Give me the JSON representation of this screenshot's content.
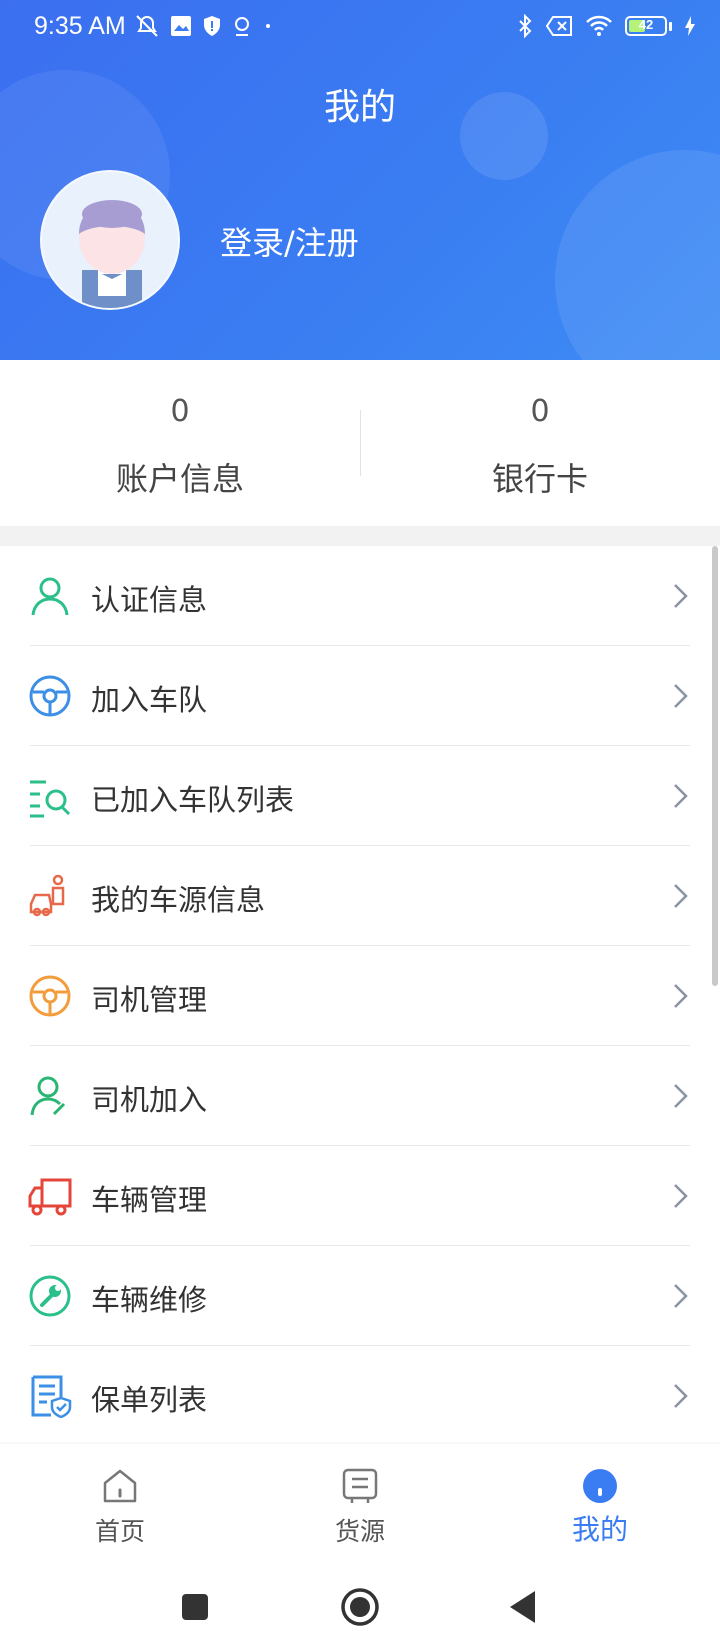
{
  "status_bar": {
    "time": "9:35 AM",
    "battery": "42"
  },
  "header": {
    "title": "我的",
    "login_label": "登录/注册"
  },
  "stats": [
    {
      "value": "0",
      "label": "账户信息"
    },
    {
      "value": "0",
      "label": "银行卡"
    }
  ],
  "menu": {
    "items": [
      {
        "label": "认证信息",
        "icon": "user-certify-icon",
        "color": "#2bc08a"
      },
      {
        "label": "加入车队",
        "icon": "steering-wheel-icon",
        "color": "#3b8fe6"
      },
      {
        "label": "已加入车队列表",
        "icon": "list-search-icon",
        "color": "#2bc08a"
      },
      {
        "label": "我的车源信息",
        "icon": "driver-car-icon",
        "color": "#e8684a"
      },
      {
        "label": "司机管理",
        "icon": "steering-wheel-icon",
        "color": "#f39c3c"
      },
      {
        "label": "司机加入",
        "icon": "user-add-icon",
        "color": "#2bb573"
      },
      {
        "label": "车辆管理",
        "icon": "truck-icon",
        "color": "#e5463a"
      },
      {
        "label": "车辆维修",
        "icon": "wrench-icon",
        "color": "#2bc08a"
      },
      {
        "label": "保单列表",
        "icon": "policy-document-icon",
        "color": "#3b8fe6"
      }
    ]
  },
  "tabbar": {
    "tabs": [
      {
        "label": "首页",
        "icon": "home-icon",
        "active": false
      },
      {
        "label": "货源",
        "icon": "cargo-list-icon",
        "active": false
      },
      {
        "label": "我的",
        "icon": "profile-icon",
        "active": true
      }
    ]
  },
  "colors": {
    "primary": "#3a7cf2",
    "text": "#333333",
    "muted": "#555555"
  }
}
